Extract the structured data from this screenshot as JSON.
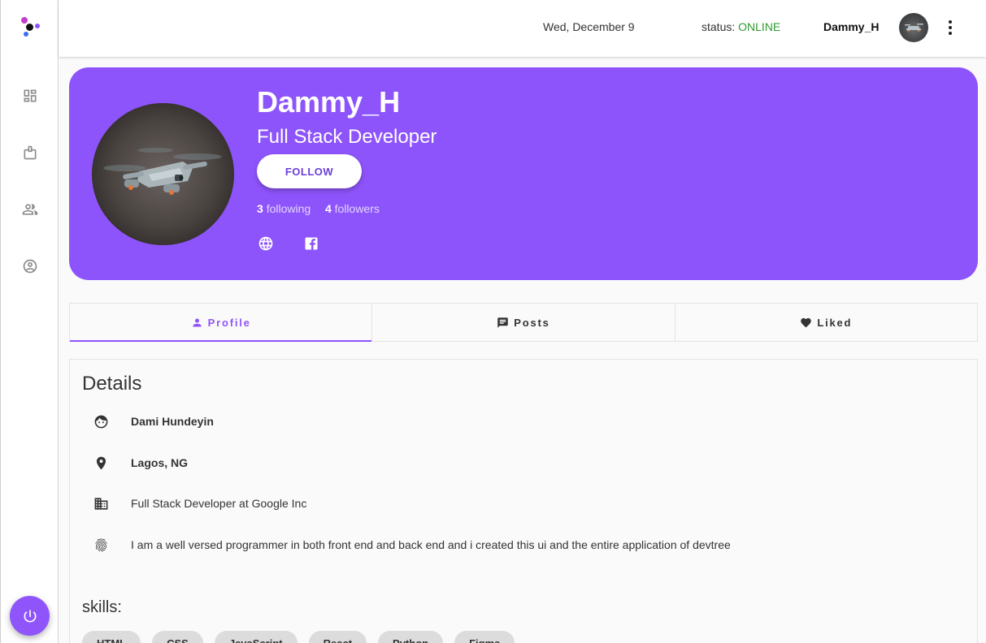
{
  "sidebar": {
    "logo": "devtree-logo",
    "items": [
      {
        "name": "dashboard-icon"
      },
      {
        "name": "clipboard-icon"
      },
      {
        "name": "people-icon"
      },
      {
        "name": "account-circle-icon"
      }
    ],
    "power_icon": "power-icon"
  },
  "topbar": {
    "date": "Wed, December 9",
    "status_label": "status: ",
    "status_value": "ONLINE",
    "username": "Dammy_H",
    "more_icon": "more-vert-icon"
  },
  "profile": {
    "username": "Dammy_H",
    "role": "Full Stack Developer",
    "follow_label": "FOLLOW",
    "following_count": "3",
    "following_label": "following",
    "followers_count": "4",
    "followers_label": "followers",
    "links": [
      "globe-icon",
      "facebook-icon"
    ]
  },
  "tabs": [
    {
      "label": "Profile",
      "icon": "person-icon",
      "active": true
    },
    {
      "label": "Posts",
      "icon": "chat-icon",
      "active": false
    },
    {
      "label": "Liked",
      "icon": "heart-icon",
      "active": false
    }
  ],
  "details": {
    "title": "Details",
    "full_name": "Dami Hundeyin",
    "location": "Lagos, NG",
    "work": "Full Stack Developer at Google Inc",
    "bio": "I am a well versed programmer in both front end and back end and i created this ui and the entire application of devtree"
  },
  "skills": {
    "title": "skills:",
    "items": [
      "HTML",
      "CSS",
      "JavaScript",
      "React",
      "Python",
      "Figma"
    ]
  },
  "colors": {
    "accent": "#8e54fb",
    "online": "#2e9c2e"
  }
}
